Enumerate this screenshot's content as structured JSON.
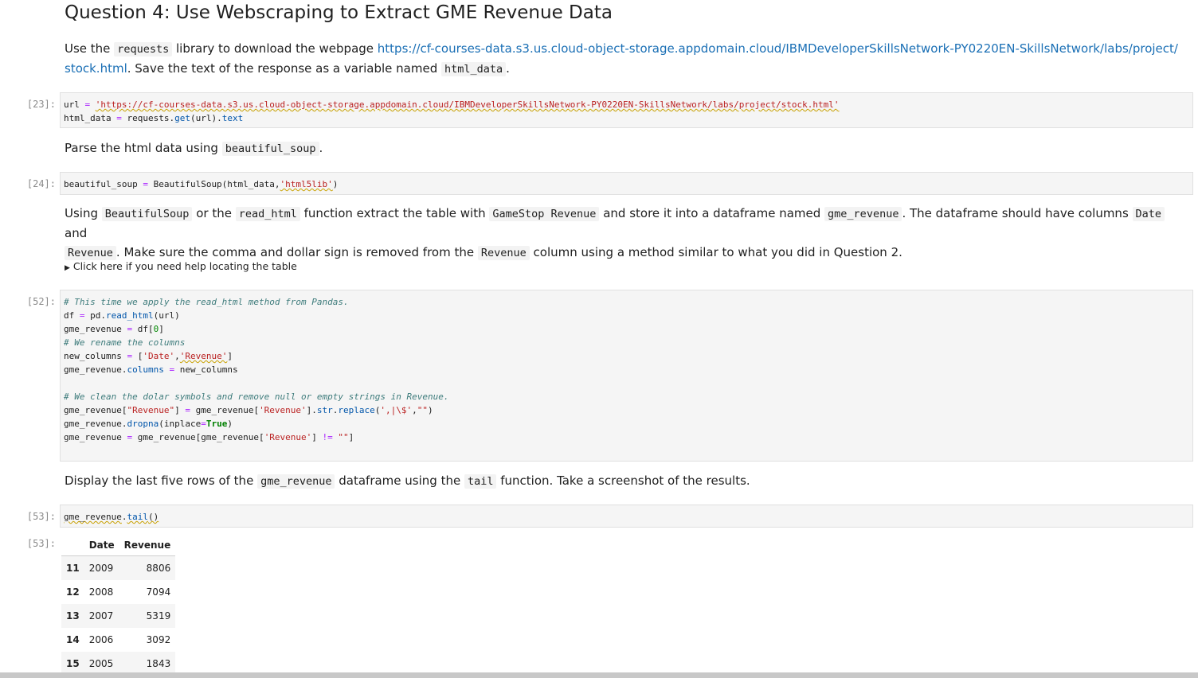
{
  "heading": "Question 4: Use Webscraping to Extract GME Revenue Data",
  "md1": {
    "t1": "Use the ",
    "c1": "requests",
    "t2": " library to download the webpage ",
    "link_line1": "https://cf-courses-data.s3.us.cloud-object-storage.appdomain.cloud/IBMDeveloperSkillsNetwork-PY0220EN-SkillsNetwork/labs/project/",
    "link_line2": "stock.html",
    "t3": ". Save the text of the response as a variable named ",
    "c2": "html_data",
    "t4": "."
  },
  "cell23": {
    "prompt": "[23]:",
    "lines": [
      "url = 'https://cf-courses-data.s3.us.cloud-object-storage.appdomain.cloud/IBMDeveloperSkillsNetwork-PY0220EN-SkillsNetwork/labs/project/stock.html'",
      "html_data = requests.get(url).text"
    ]
  },
  "md2": {
    "t1": "Parse the html data using ",
    "c1": "beautiful_soup",
    "t2": "."
  },
  "cell24": {
    "prompt": "[24]:",
    "lines": [
      "beautiful_soup = BeautifulSoup(html_data,'html5lib')"
    ]
  },
  "md3": {
    "t1": "Using ",
    "c1": "BeautifulSoup",
    "t2": " or the ",
    "c2": "read_html",
    "t3": " function extract the table with ",
    "c3": "GameStop Revenue",
    "t4": " and store it into a dataframe named ",
    "c4": "gme_revenue",
    "t5": ". The dataframe should have columns ",
    "c5": "Date",
    "t6": " and",
    "c6": "Revenue",
    "t7": ". Make sure the comma and dollar sign is removed from the ",
    "c7": "Revenue",
    "t8": " column using a method similar to what you did in Question 2."
  },
  "details_label": "Click here if you need help locating the table",
  "cell52": {
    "prompt": "[52]:",
    "lines": [
      "# This time we apply the read_html method from Pandas.",
      "df = pd.read_html(url)",
      "gme_revenue = df[0]",
      "# We rename the columns",
      "new_columns = ['Date','Revenue']",
      "gme_revenue.columns = new_columns",
      "",
      "# We clean the dolar symbols and remove null or empty strings in Revenue.",
      "gme_revenue[\"Revenue\"] = gme_revenue['Revenue'].str.replace(',|\\$',\"\")",
      "gme_revenue.dropna(inplace=True)",
      "gme_revenue = gme_revenue[gme_revenue['Revenue'] != \"\"]"
    ]
  },
  "md4": {
    "t1": "Display the last five rows of the ",
    "c1": "gme_revenue",
    "t2": " dataframe using the ",
    "c2": "tail",
    "t3": " function. Take a screenshot of the results."
  },
  "cell53": {
    "prompt": "[53]:",
    "lines": [
      "gme_revenue.tail()"
    ]
  },
  "out53": {
    "prompt": "[53]:",
    "columns": [
      "",
      "Date",
      "Revenue"
    ],
    "rows": [
      {
        "index": "11",
        "date": "2009",
        "revenue": "8806"
      },
      {
        "index": "12",
        "date": "2008",
        "revenue": "7094"
      },
      {
        "index": "13",
        "date": "2007",
        "revenue": "5319"
      },
      {
        "index": "14",
        "date": "2006",
        "revenue": "3092"
      },
      {
        "index": "15",
        "date": "2005",
        "revenue": "1843"
      }
    ]
  }
}
